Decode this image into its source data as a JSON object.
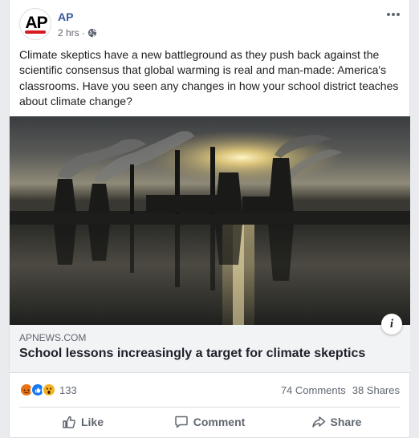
{
  "post": {
    "page_name": "AP",
    "avatar_text": "AP",
    "time": "2 hrs",
    "separator": "·",
    "text": "Climate skeptics have a new battleground as they push back against the scientific consensus that global warming is real and man-made: America's classrooms. Have you seen any changes in how your school district teaches about climate change?"
  },
  "link": {
    "domain": "APNEWS.COM",
    "title": "School lessons increasingly a target for climate skeptics"
  },
  "stats": {
    "reaction_count": "133",
    "comments": "74 Comments",
    "shares": "38 Shares"
  },
  "actions": {
    "like": "Like",
    "comment": "Comment",
    "share": "Share"
  },
  "colors": {
    "page_name": "#385898",
    "ap_red": "#d71920",
    "like_blue": "#1877f2",
    "angry": "#e9710f",
    "wow": "#f7b125"
  },
  "icons": [
    "globe-icon",
    "more-options-icon",
    "info-icon",
    "angry-reaction-icon",
    "like-reaction-icon",
    "wow-reaction-icon",
    "like-icon",
    "comment-icon",
    "share-icon"
  ]
}
